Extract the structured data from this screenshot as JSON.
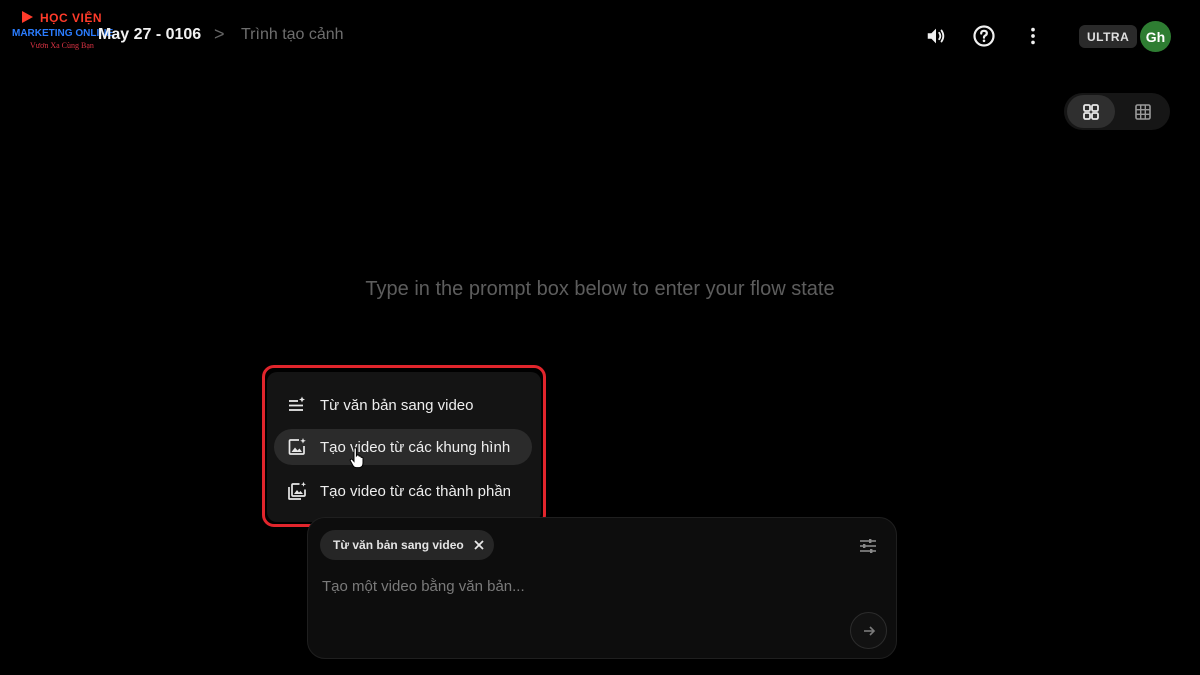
{
  "watermark": {
    "line1": "HỌC VIỆN",
    "line2": "MARKETING ONLINE",
    "line3": "Vươn Xa Cùng Bạn"
  },
  "header": {
    "project_title": "May 27 - 0106",
    "separator": ">",
    "page_name": "Trình tạo cảnh",
    "plan_badge": "ULTRA",
    "avatar_initials": "Gh"
  },
  "icons": {
    "volume": "volume-icon",
    "help": "help-icon",
    "more": "more-vert-icon",
    "view_grid_large": "grid-large-icon",
    "view_grid_small": "grid-small-icon"
  },
  "main": {
    "empty_hint": "Type in the prompt box below to enter your flow state"
  },
  "mode_menu": {
    "items": [
      {
        "label": "Từ văn bản sang video",
        "icon": "text-to-video-icon"
      },
      {
        "label": "Tạo video từ các khung hình",
        "icon": "frames-to-video-icon"
      },
      {
        "label": "Tạo video từ các thành phần",
        "icon": "ingredients-to-video-icon"
      }
    ],
    "hovered_index": 1
  },
  "prompt": {
    "mode_chip": "Từ văn bản sang video",
    "placeholder": "Tạo một video bằng văn bản..."
  },
  "colors": {
    "background": "#000000",
    "highlight_border": "#e1252c",
    "avatar_bg": "#2e7d32"
  }
}
